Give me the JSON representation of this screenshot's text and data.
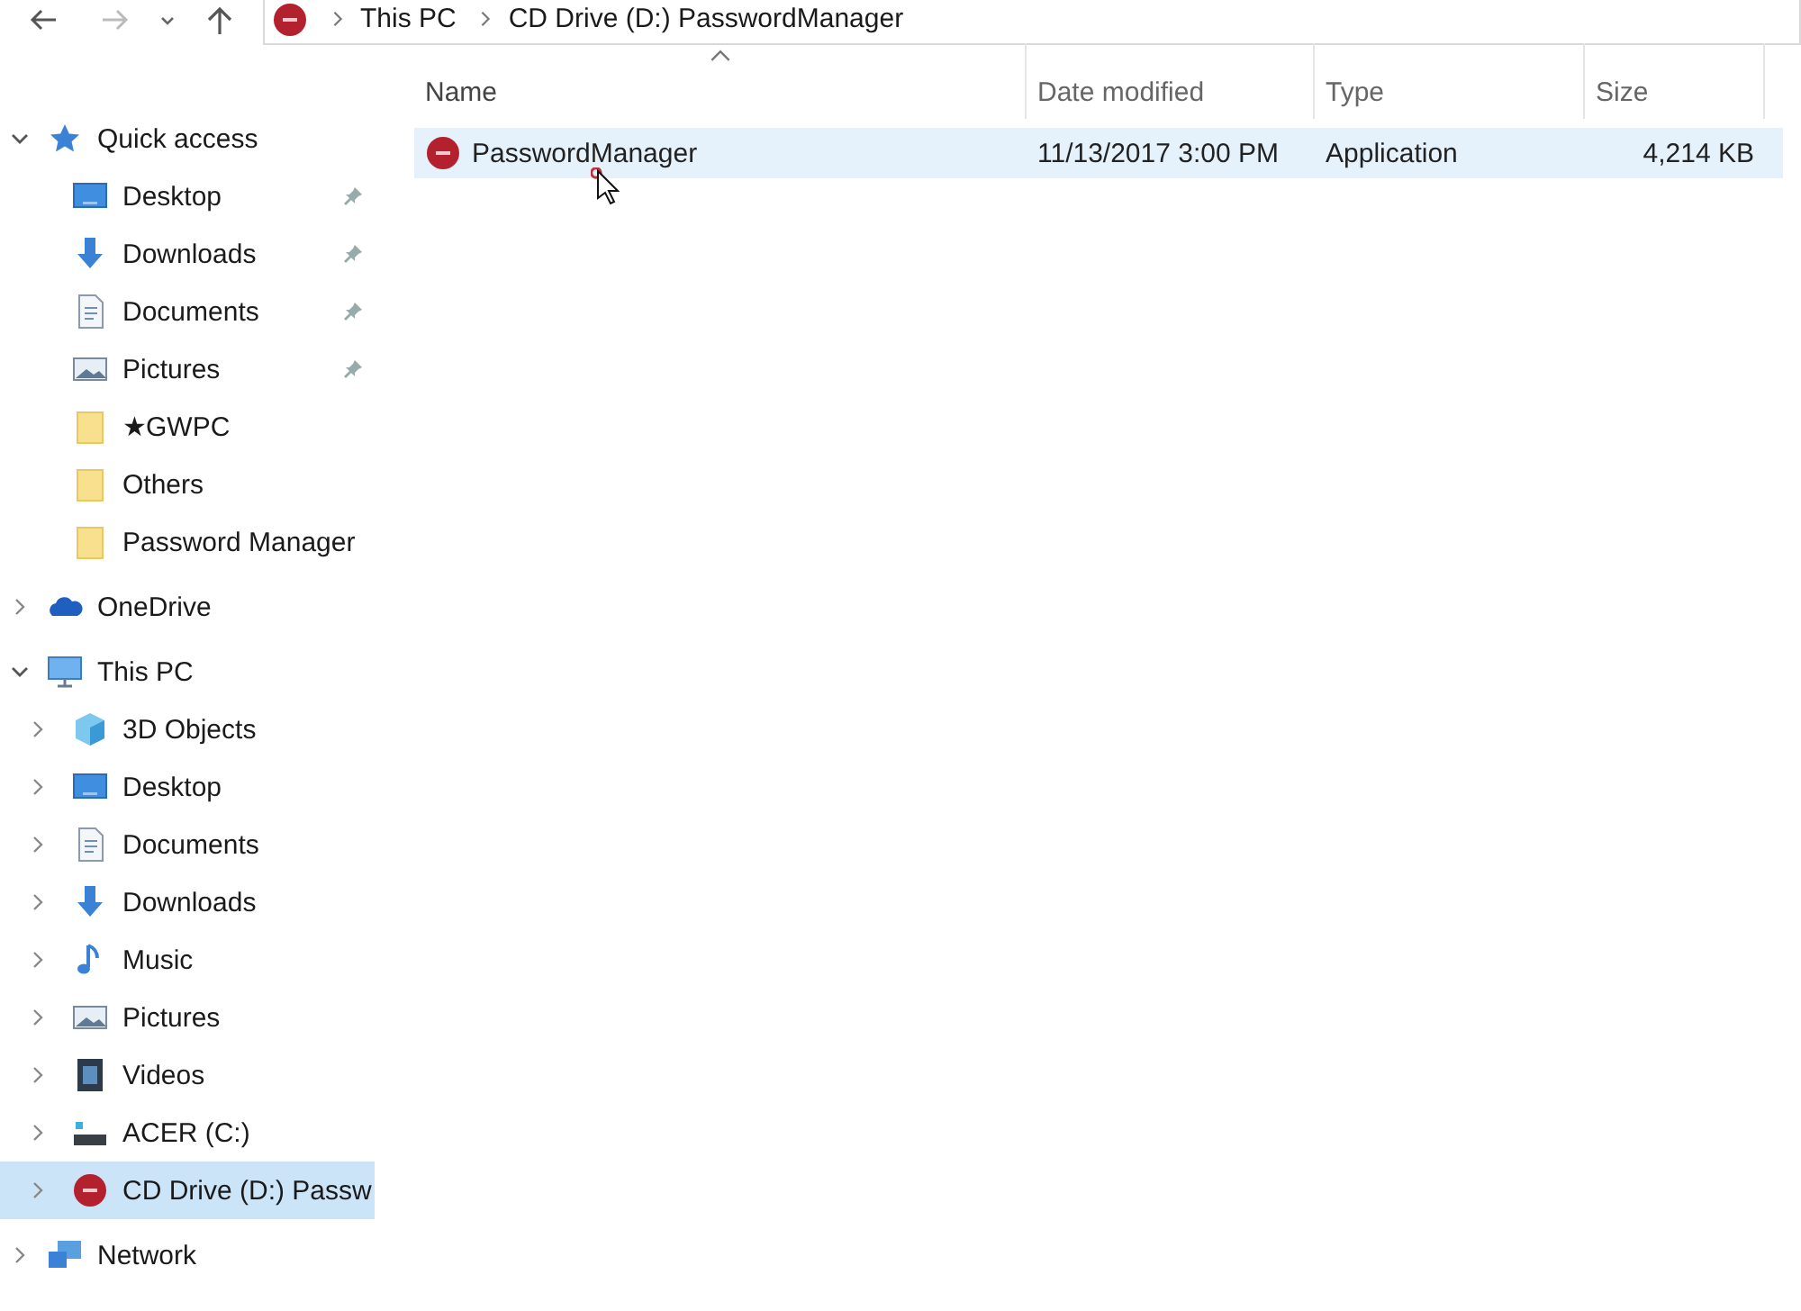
{
  "address_bar": {
    "breadcrumbs": [
      "This PC",
      "CD Drive (D:) PasswordManager"
    ]
  },
  "sidebar": {
    "sections": [
      {
        "label": "Quick access",
        "kind": "star",
        "expanded": true,
        "selected": false,
        "children": [
          {
            "label": "Desktop",
            "kind": "desktop",
            "pinned": true,
            "expandable": false,
            "selected": false
          },
          {
            "label": "Downloads",
            "kind": "downloads",
            "pinned": true,
            "expandable": false,
            "selected": false
          },
          {
            "label": "Documents",
            "kind": "documents",
            "pinned": true,
            "expandable": false,
            "selected": false
          },
          {
            "label": "Pictures",
            "kind": "pictures",
            "pinned": true,
            "expandable": false,
            "selected": false
          },
          {
            "label": "★GWPC",
            "kind": "folder",
            "pinned": false,
            "expandable": false,
            "selected": false
          },
          {
            "label": "Others",
            "kind": "folder",
            "pinned": false,
            "expandable": false,
            "selected": false
          },
          {
            "label": "Password Manager",
            "kind": "folder",
            "pinned": false,
            "expandable": false,
            "selected": false
          }
        ]
      },
      {
        "label": "OneDrive",
        "kind": "cloud",
        "expanded": false,
        "selected": false
      },
      {
        "label": "This PC",
        "kind": "pc",
        "expanded": true,
        "selected": false,
        "children": [
          {
            "label": "3D Objects",
            "kind": "cube",
            "pinned": false,
            "expandable": true,
            "selected": false
          },
          {
            "label": "Desktop",
            "kind": "desktop",
            "pinned": false,
            "expandable": true,
            "selected": false
          },
          {
            "label": "Documents",
            "kind": "documents",
            "pinned": false,
            "expandable": true,
            "selected": false
          },
          {
            "label": "Downloads",
            "kind": "downloads",
            "pinned": false,
            "expandable": true,
            "selected": false
          },
          {
            "label": "Music",
            "kind": "music",
            "pinned": false,
            "expandable": true,
            "selected": false
          },
          {
            "label": "Pictures",
            "kind": "pictures",
            "pinned": false,
            "expandable": true,
            "selected": false
          },
          {
            "label": "Videos",
            "kind": "videos",
            "pinned": false,
            "expandable": true,
            "selected": false
          },
          {
            "label": "ACER (C:)",
            "kind": "drive",
            "pinned": false,
            "expandable": true,
            "selected": false
          },
          {
            "label": "CD Drive (D:) Passw",
            "kind": "app",
            "pinned": false,
            "expandable": true,
            "selected": true
          }
        ]
      },
      {
        "label": "Network",
        "kind": "network",
        "expanded": false,
        "selected": false
      }
    ]
  },
  "file_list": {
    "columns": [
      {
        "label": "Name",
        "sorted": true
      },
      {
        "label": "Date modified",
        "sorted": false
      },
      {
        "label": "Type",
        "sorted": false
      },
      {
        "label": "Size",
        "sorted": false
      }
    ],
    "rows": [
      {
        "name": "PasswordManager",
        "kind": "app",
        "date_modified": "11/13/2017 3:00 PM",
        "type": "Application",
        "size": "4,214 KB",
        "selected": true
      }
    ]
  }
}
